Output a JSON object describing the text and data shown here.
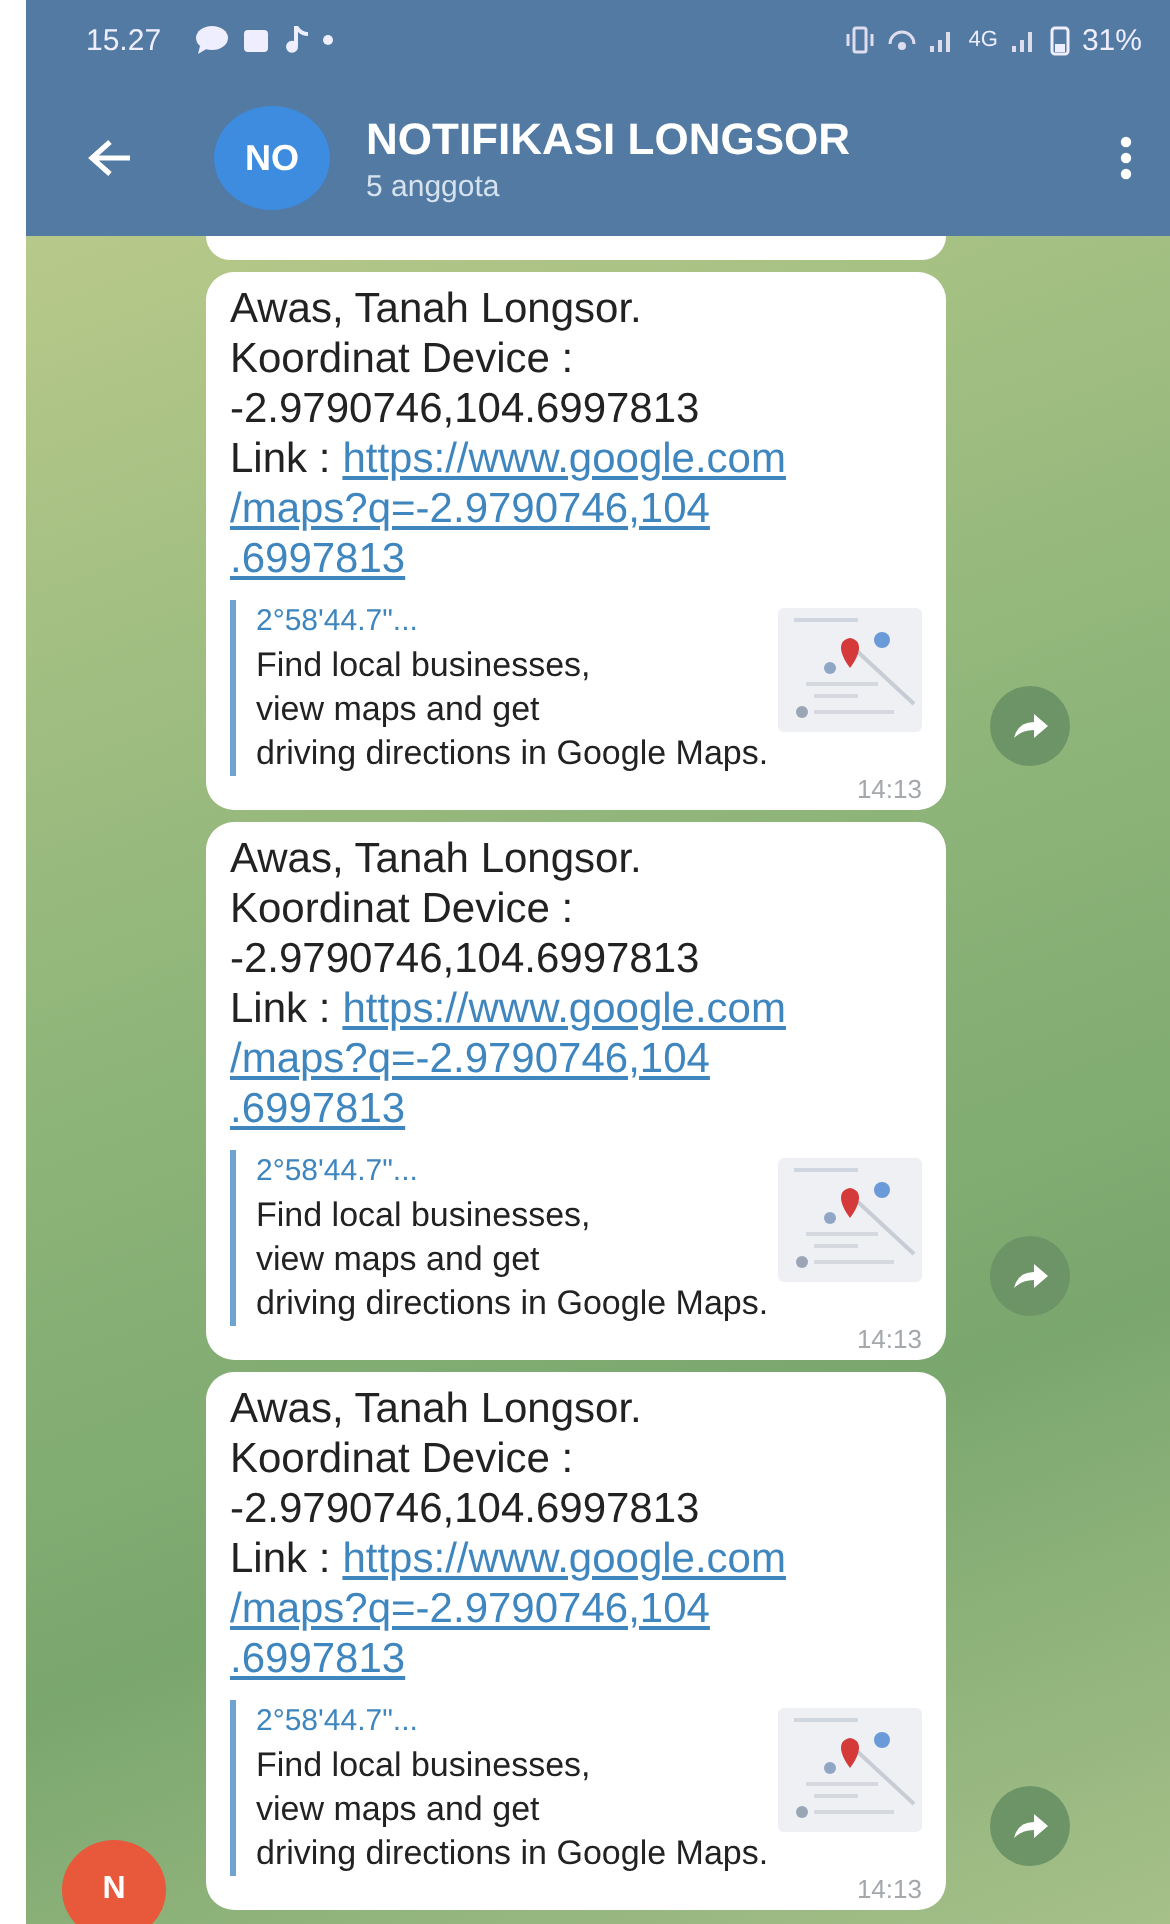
{
  "status_bar": {
    "time": "15.27",
    "network": "4G",
    "battery": "31%"
  },
  "header": {
    "avatar": "NO",
    "title": "NOTIFIKASI LONGSOR",
    "subtitle": "5 anggota"
  },
  "messages": [
    {
      "text_lines": [
        "Awas, Tanah Longsor.",
        "Koordinat Device :",
        "-2.9790746,104.6997813"
      ],
      "link_label": "Link :",
      "link_lines": [
        "https://www.google.com",
        "/maps?q=-2.9790746,104",
        ".6997813"
      ],
      "preview": {
        "title": "2°58'44.7\"...",
        "lines": [
          "Find local businesses,",
          "view maps and get",
          "driving directions in Google Maps."
        ]
      },
      "time": "14:13"
    },
    {
      "text_lines": [
        "Awas, Tanah Longsor.",
        "Koordinat Device :",
        "-2.9790746,104.6997813"
      ],
      "link_label": "Link :",
      "link_lines": [
        "https://www.google.com",
        "/maps?q=-2.9790746,104",
        ".6997813"
      ],
      "preview": {
        "title": "2°58'44.7\"...",
        "lines": [
          "Find local businesses,",
          "view maps and get",
          "driving directions in Google Maps."
        ]
      },
      "time": "14:13"
    },
    {
      "text_lines": [
        "Awas, Tanah Longsor.",
        "Koordinat Device :",
        "-2.9790746,104.6997813"
      ],
      "link_label": "Link :",
      "link_lines": [
        "https://www.google.com",
        "/maps?q=-2.9790746,104",
        ".6997813"
      ],
      "preview": {
        "title": "2°58'44.7\"...",
        "lines": [
          "Find local businesses,",
          "view maps and get",
          "driving directions in Google Maps."
        ]
      },
      "time": "14:13"
    }
  ],
  "sender_avatar": "N"
}
